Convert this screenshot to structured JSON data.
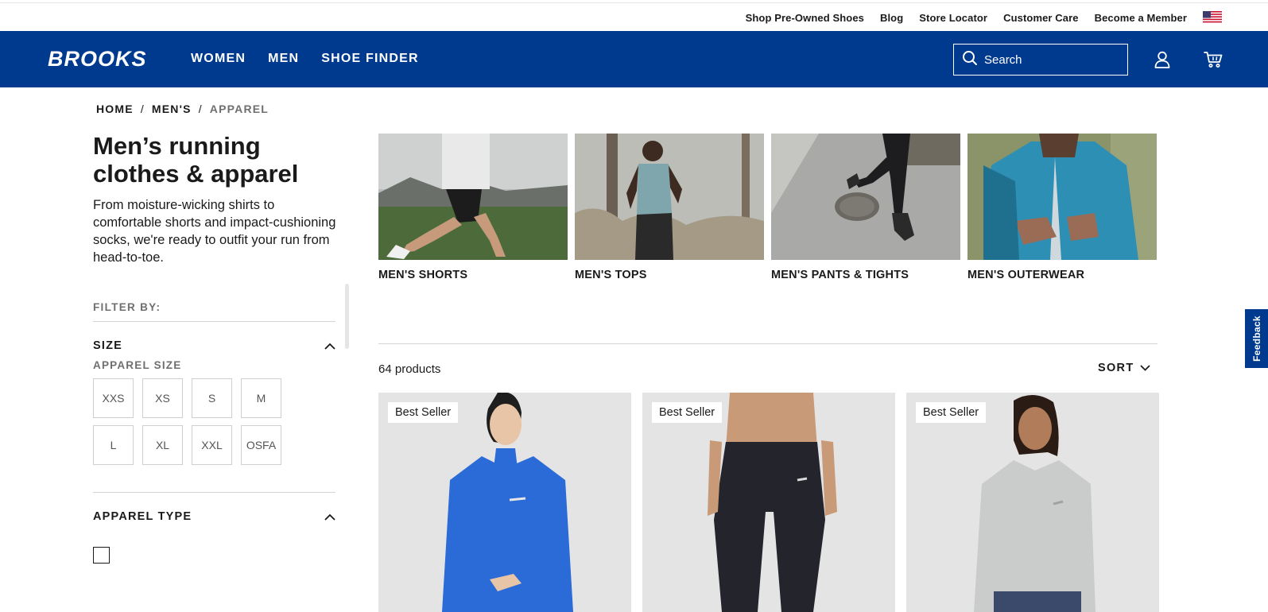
{
  "utility_nav": {
    "links": [
      "Shop Pre-Owned Shoes",
      "Blog",
      "Store Locator",
      "Customer Care",
      "Become a Member"
    ]
  },
  "header": {
    "logo": "BROOKS",
    "nav": [
      "WOMEN",
      "MEN",
      "SHOE FINDER"
    ],
    "search_placeholder": "Search"
  },
  "breadcrumb": {
    "items": [
      "HOME",
      "MEN'S",
      "APPAREL"
    ],
    "separator": "/"
  },
  "page": {
    "title": "Men’s running clothes & apparel",
    "description": "From moisture-wicking shirts to comfortable shorts and impact-cushioning socks, we're ready to outfit your run from head-to-toe."
  },
  "filters": {
    "heading": "FILTER BY:",
    "size_label": "SIZE",
    "apparel_size_label": "APPAREL SIZE",
    "sizes": [
      "XXS",
      "XS",
      "S",
      "M",
      "L",
      "XL",
      "XXL",
      "OSFA"
    ],
    "apparel_type_label": "APPAREL TYPE"
  },
  "categories": [
    {
      "label": "MEN'S SHORTS"
    },
    {
      "label": "MEN'S TOPS"
    },
    {
      "label": "MEN'S PANTS & TIGHTS"
    },
    {
      "label": "MEN'S OUTERWEAR"
    }
  ],
  "results": {
    "count_text": "64 products",
    "sort_label": "SORT"
  },
  "products": [
    {
      "badge": "Best Seller"
    },
    {
      "badge": "Best Seller"
    },
    {
      "badge": "Best Seller"
    }
  ],
  "feedback_label": "Feedback",
  "colors": {
    "brand_blue": "#003a8f",
    "text": "#1a1a1a",
    "muted": "#6f6f6f"
  }
}
